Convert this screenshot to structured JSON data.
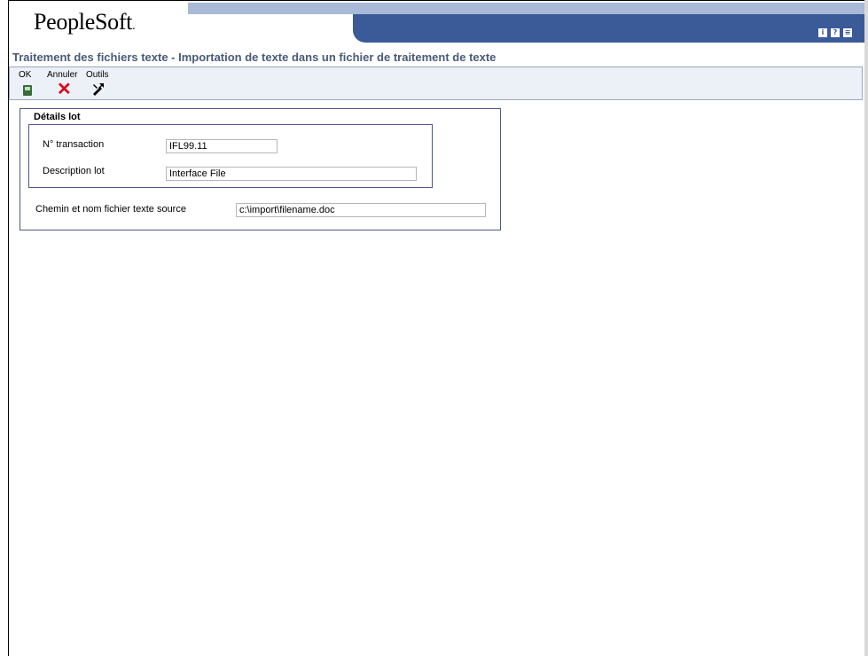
{
  "header": {
    "logo_text": "PeopleSoft",
    "logo_dot": ".",
    "icons": [
      "info-icon",
      "help-icon",
      "menu-icon"
    ],
    "icon_glyphs": [
      "i",
      "?",
      "≡"
    ]
  },
  "page": {
    "title": "Traitement des fichiers texte - Importation de texte dans un fichier de traitement de texte"
  },
  "toolbar": {
    "ok_label": "OK",
    "cancel_label": "Annuler",
    "tools_label": "Outils"
  },
  "form": {
    "group_title": "Détails lot",
    "transaction_label": "N° transaction",
    "transaction_value": "IFL99.11",
    "batch_desc_label": "Description lot",
    "batch_desc_value": "Interface File",
    "source_path_label": "Chemin et nom fichier texte source",
    "source_path_value": "c:\\import\\filename.doc"
  },
  "colors": {
    "banner_dark": "#3a5a98",
    "banner_light": "#a9b9d8",
    "title_text": "#4a5a78",
    "cancel_red": "#e0001b"
  }
}
